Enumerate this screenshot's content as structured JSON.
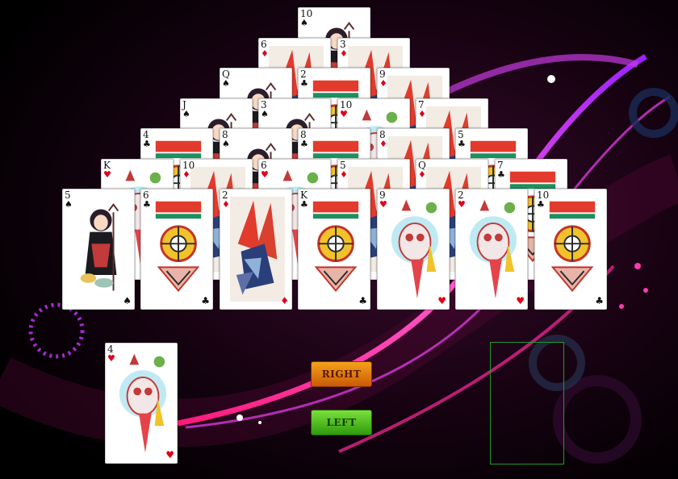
{
  "colors": {
    "background": "#000000",
    "swoosh_pink": "#ff2aa0",
    "swoosh_purple": "#a020f0",
    "button_right": "#e07a10",
    "button_left": "#4cc023",
    "empty_slot_border": "#1e9a2a"
  },
  "buttons": {
    "right_label": "RIGHT",
    "left_label": "LEFT"
  },
  "pyramid": [
    [
      {
        "rank": "10",
        "suit": "♠",
        "color": "black",
        "art": "figure"
      }
    ],
    [
      {
        "rank": "6",
        "suit": "♦",
        "color": "red",
        "art": "shards"
      },
      {
        "rank": "3",
        "suit": "♦",
        "color": "red",
        "art": "shards"
      }
    ],
    [
      {
        "rank": "Q",
        "suit": "♠",
        "color": "black",
        "art": "figure"
      },
      {
        "rank": "2",
        "suit": "♣",
        "color": "black",
        "art": "tribal"
      },
      {
        "rank": "9",
        "suit": "♦",
        "color": "red",
        "art": "shards"
      }
    ],
    [
      {
        "rank": "J",
        "suit": "♠",
        "color": "black",
        "art": "figure"
      },
      {
        "rank": "3",
        "suit": "♠",
        "color": "black",
        "art": "figure"
      },
      {
        "rank": "10",
        "suit": "♥",
        "color": "red",
        "art": "monster"
      },
      {
        "rank": "7",
        "suit": "♦",
        "color": "red",
        "art": "shards"
      }
    ],
    [
      {
        "rank": "4",
        "suit": "♣",
        "color": "black",
        "art": "tribal"
      },
      {
        "rank": "8",
        "suit": "♠",
        "color": "black",
        "art": "figure"
      },
      {
        "rank": "8",
        "suit": "♣",
        "color": "black",
        "art": "tribal"
      },
      {
        "rank": "8",
        "suit": "♦",
        "color": "red",
        "art": "shards"
      },
      {
        "rank": "5",
        "suit": "♣",
        "color": "black",
        "art": "tribal"
      }
    ],
    [
      {
        "rank": "K",
        "suit": "♥",
        "color": "red",
        "art": "monster"
      },
      {
        "rank": "10",
        "suit": "♦",
        "color": "red",
        "art": "shards"
      },
      {
        "rank": "6",
        "suit": "♥",
        "color": "red",
        "art": "monster"
      },
      {
        "rank": "5",
        "suit": "♦",
        "color": "red",
        "art": "shards"
      },
      {
        "rank": "Q",
        "suit": "♦",
        "color": "red",
        "art": "shards"
      },
      {
        "rank": "7",
        "suit": "♣",
        "color": "black",
        "art": "tribal"
      }
    ],
    [
      {
        "rank": "5",
        "suit": "♠",
        "color": "black",
        "art": "figure"
      },
      {
        "rank": "6",
        "suit": "♣",
        "color": "black",
        "art": "tribal"
      },
      {
        "rank": "2",
        "suit": "♦",
        "color": "red",
        "art": "shards"
      },
      {
        "rank": "K",
        "suit": "♣",
        "color": "black",
        "art": "tribal"
      },
      {
        "rank": "9",
        "suit": "♥",
        "color": "red",
        "art": "monster"
      },
      {
        "rank": "2",
        "suit": "♥",
        "color": "red",
        "art": "monster"
      },
      {
        "rank": "10",
        "suit": "♣",
        "color": "black",
        "art": "tribal"
      }
    ]
  ],
  "stock_card": {
    "rank": "4",
    "suit": "♥",
    "color": "red",
    "art": "monster"
  },
  "discard_pile": {
    "empty": true
  }
}
